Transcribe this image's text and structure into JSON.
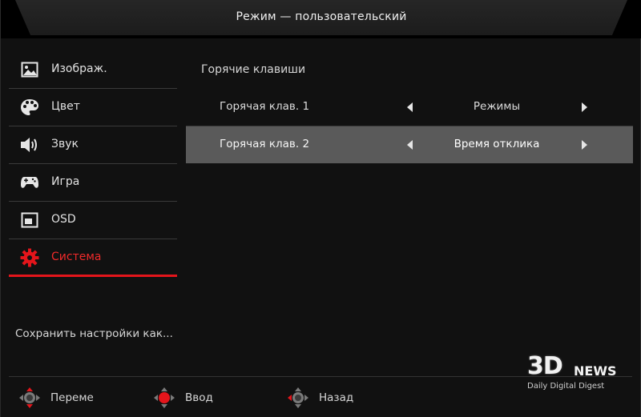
{
  "header": {
    "title": "Режим — пользовательский"
  },
  "sidebar": {
    "items": [
      {
        "label": "Изображ.",
        "icon": "image-icon"
      },
      {
        "label": "Цвет",
        "icon": "palette-icon"
      },
      {
        "label": "Звук",
        "icon": "speaker-icon"
      },
      {
        "label": "Игра",
        "icon": "gamepad-icon"
      },
      {
        "label": "OSD",
        "icon": "osd-window-icon"
      },
      {
        "label": "Система",
        "icon": "gear-icon",
        "active": true
      }
    ],
    "save_settings": "Сохранить настройки как..."
  },
  "main": {
    "section_title": "Горячие клавиши",
    "rows": [
      {
        "label": "Горячая клав. 1",
        "value": "Режимы",
        "selected": false
      },
      {
        "label": "Горячая клав. 2",
        "value": "Время отклика",
        "selected": true
      }
    ]
  },
  "footer": {
    "nav": [
      {
        "label": "Переме",
        "icon": "dpad-move-icon"
      },
      {
        "label": "Ввод",
        "icon": "dpad-enter-icon"
      },
      {
        "label": "Назад",
        "icon": "dpad-back-icon"
      }
    ]
  },
  "watermark": {
    "logo": "3D",
    "logo_suffix": "NEWS",
    "tagline": "Daily Digital Digest"
  },
  "colors": {
    "accent": "#e4151b",
    "selected_row": "#5a5a5a",
    "background": "#111111"
  }
}
